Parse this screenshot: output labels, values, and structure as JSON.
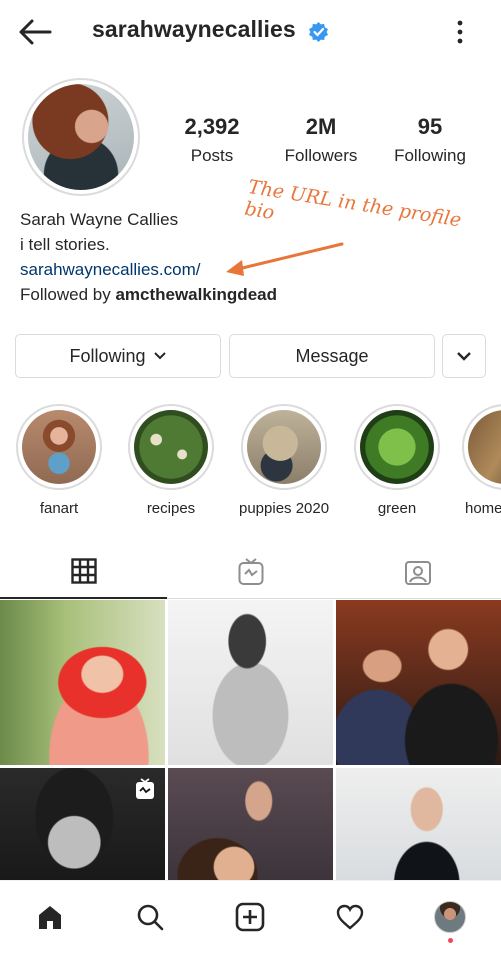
{
  "header": {
    "username": "sarahwaynecallies"
  },
  "stats": [
    {
      "value": "2,392",
      "label": "Posts"
    },
    {
      "value": "2M",
      "label": "Followers"
    },
    {
      "value": "95",
      "label": "Following"
    }
  ],
  "bio": {
    "name": "Sarah Wayne Callies",
    "text": "i tell stories.",
    "link": "sarahwaynecallies.com/",
    "followed_prefix": "Followed by ",
    "followed_by": "amcthewalkingdead"
  },
  "annotation": "The URL in the profile bio",
  "buttons": {
    "following": "Following",
    "message": "Message"
  },
  "highlights": [
    {
      "label": "fanart"
    },
    {
      "label": "recipes"
    },
    {
      "label": "puppies 2020"
    },
    {
      "label": "green"
    },
    {
      "label": "home"
    }
  ],
  "colors": {
    "annotation": "#e8763a",
    "link": "#00376b",
    "verified": "#3897f0",
    "notification_dot": "#ed4956"
  }
}
